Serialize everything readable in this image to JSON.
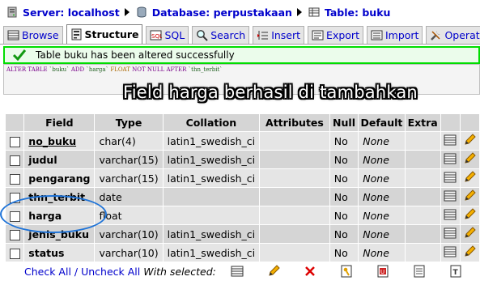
{
  "breadcrumb": {
    "server": "Server: localhost",
    "database": "Database: perpustakaan",
    "table": "Table: buku"
  },
  "tabs": [
    {
      "label": "Browse",
      "icon": "browse-icon",
      "active": false
    },
    {
      "label": "Structure",
      "icon": "structure-icon",
      "active": true
    },
    {
      "label": "SQL",
      "icon": "sql-icon",
      "active": false
    },
    {
      "label": "Search",
      "icon": "search-icon",
      "active": false
    },
    {
      "label": "Insert",
      "icon": "insert-icon",
      "active": false
    },
    {
      "label": "Export",
      "icon": "export-icon",
      "active": false
    },
    {
      "label": "Import",
      "icon": "import-icon",
      "active": false
    },
    {
      "label": "Operation",
      "icon": "operations-icon",
      "active": false
    }
  ],
  "notice": {
    "message": "Table buku has been altered successfully",
    "color": "#00dd00"
  },
  "sql": {
    "kw1": "ALTER TABLE",
    "tbl": "`buku`",
    "kw2": "ADD",
    "col": "`harga`",
    "type": "FLOAT",
    "kw3": "NOT NULL AFTER",
    "after": "`thn_terbit`"
  },
  "caption": "Field harga berhasil di tambahkan",
  "table": {
    "headers": [
      "Field",
      "Type",
      "Collation",
      "Attributes",
      "Null",
      "Default",
      "Extra"
    ],
    "rows": [
      {
        "field": "no_buku",
        "type": "char(4)",
        "collation": "latin1_swedish_ci",
        "attributes": "",
        "null": "No",
        "default": "None",
        "extra": "",
        "primary": true
      },
      {
        "field": "judul",
        "type": "varchar(15)",
        "collation": "latin1_swedish_ci",
        "attributes": "",
        "null": "No",
        "default": "None",
        "extra": "",
        "primary": false
      },
      {
        "field": "pengarang",
        "type": "varchar(15)",
        "collation": "latin1_swedish_ci",
        "attributes": "",
        "null": "No",
        "default": "None",
        "extra": "",
        "primary": false
      },
      {
        "field": "thn_terbit",
        "type": "date",
        "collation": "",
        "attributes": "",
        "null": "No",
        "default": "None",
        "extra": "",
        "primary": false
      },
      {
        "field": "harga",
        "type": "float",
        "collation": "",
        "attributes": "",
        "null": "No",
        "default": "None",
        "extra": "",
        "primary": false
      },
      {
        "field": "jenis_buku",
        "type": "varchar(10)",
        "collation": "latin1_swedish_ci",
        "attributes": "",
        "null": "No",
        "default": "None",
        "extra": "",
        "primary": false
      },
      {
        "field": "status",
        "type": "varchar(10)",
        "collation": "latin1_swedish_ci",
        "attributes": "",
        "null": "No",
        "default": "None",
        "extra": "",
        "primary": false
      }
    ]
  },
  "footer": {
    "check_all": "Check All / Uncheck All",
    "with_selected": "With selected:"
  },
  "colors": {
    "link": "#0000cc",
    "highlight_ellipse": "#1e73d8"
  }
}
